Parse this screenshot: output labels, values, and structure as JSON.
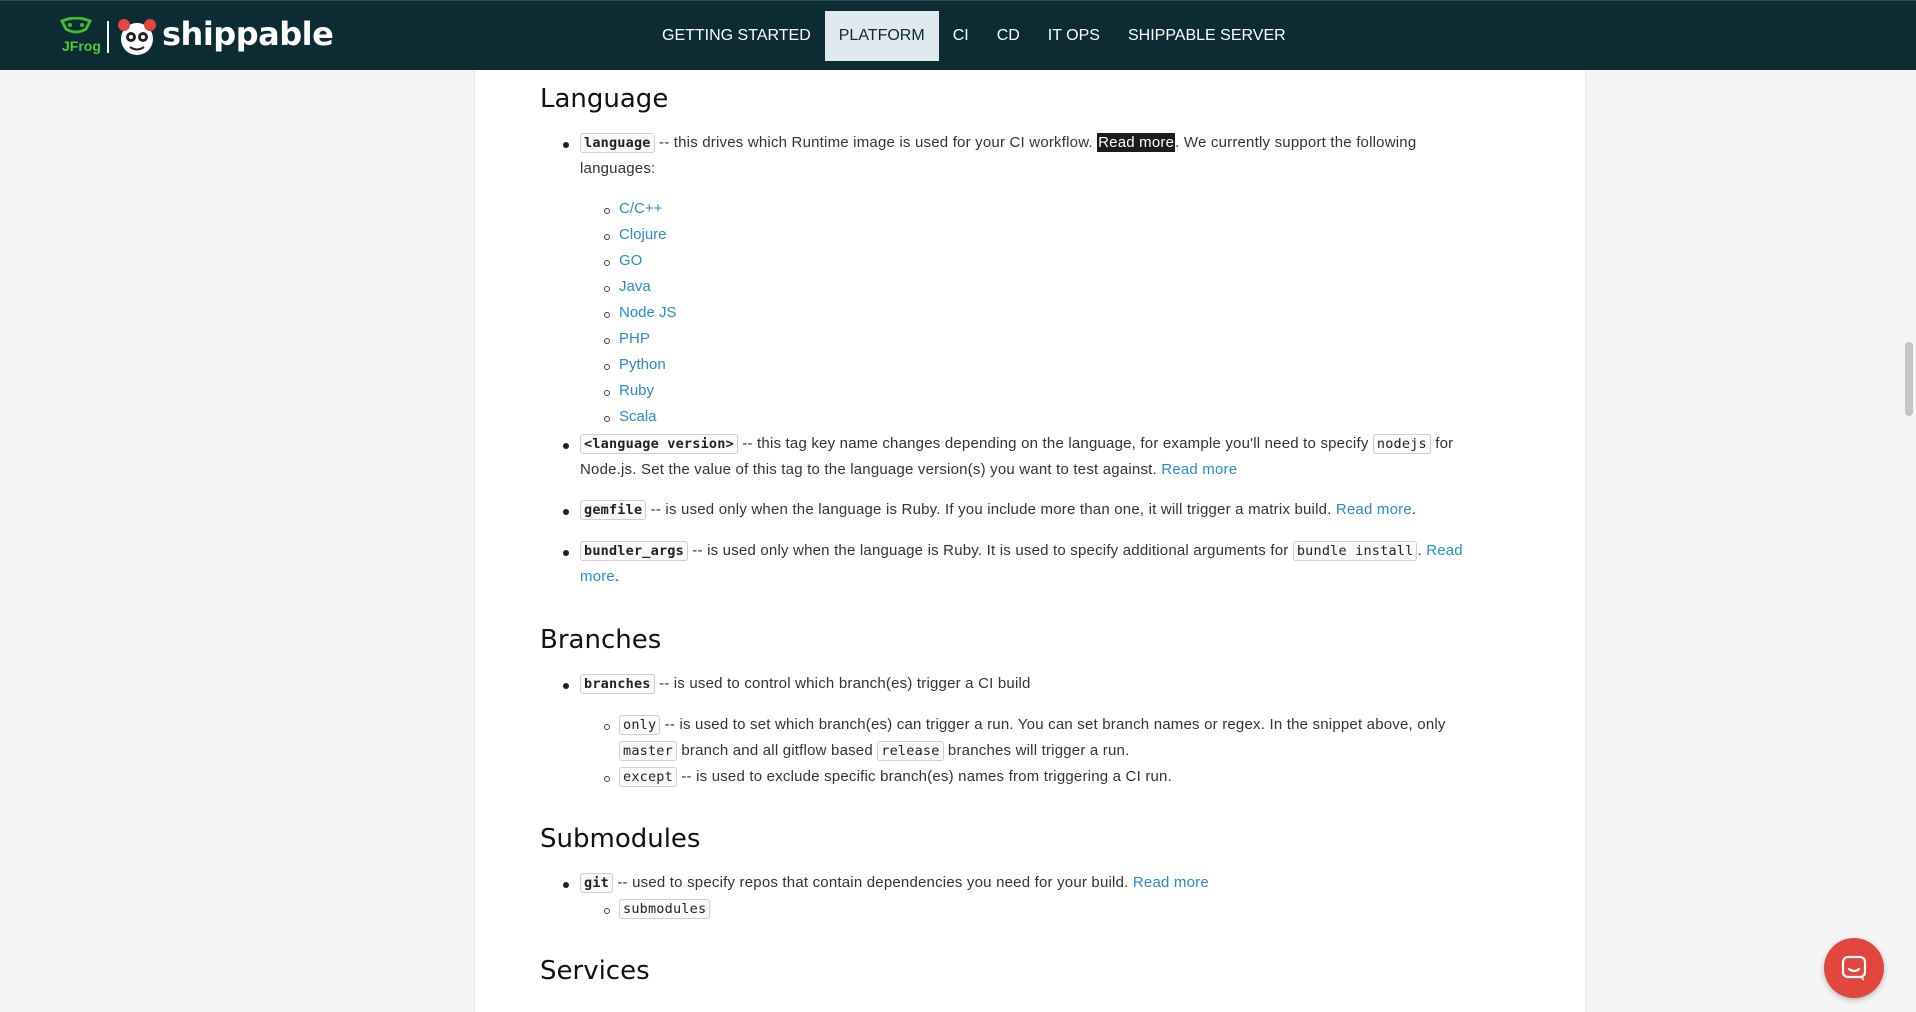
{
  "brand": {
    "jfrog": "JFrog",
    "name": "shippable"
  },
  "nav": [
    {
      "label": "GETTING STARTED",
      "active": false
    },
    {
      "label": "PLATFORM",
      "active": true
    },
    {
      "label": "CI",
      "active": false
    },
    {
      "label": "CD",
      "active": false
    },
    {
      "label": "IT OPS",
      "active": false
    },
    {
      "label": "SHIPPABLE SERVER",
      "active": false
    }
  ],
  "language": {
    "heading": "Language",
    "item1": {
      "code": "language",
      "text_a": " -- this drives which Runtime image is used for your CI workflow. ",
      "link": "Read more",
      "text_b": ". We currently support the following",
      "text_c": "languages:"
    },
    "languages": [
      "C/C++",
      "Clojure",
      "GO",
      "Java",
      "Node JS",
      "PHP",
      "Python",
      "Ruby",
      "Scala"
    ],
    "item2": {
      "code": "<language version>",
      "text_a": " -- this tag key name changes depending on the language, for example you'll need to specify ",
      "code2": "nodejs",
      "text_b": " for",
      "text_c": "Node.js. Set the value of this tag to the language version(s) you want to test against. ",
      "link": "Read more"
    },
    "item3": {
      "code": "gemfile",
      "text_a": " -- is used only when the language is Ruby. If you include more than one, it will trigger a matrix build. ",
      "link": "Read more",
      "text_b": "."
    },
    "item4": {
      "code": "bundler_args",
      "text_a": " -- is used only when the language is Ruby. It is used to specify additional arguments for ",
      "code2": "bundle install",
      "text_b": ". ",
      "link_a": "Read",
      "link_b": "more",
      "text_c": "."
    }
  },
  "branches": {
    "heading": "Branches",
    "item1": {
      "code": "branches",
      "text": " -- is used to control which branch(es) trigger a CI build"
    },
    "only": {
      "code": "only",
      "text_a": " -- is used to set which branch(es) can trigger a run. You can set branch names or regex. In the snippet above, only",
      "code2": "master",
      "text_b": " branch and all gitflow based ",
      "code3": "release",
      "text_c": " branches will trigger a run."
    },
    "except": {
      "code": "except",
      "text": " -- is used to exclude specific branch(es) names from triggering a CI run."
    }
  },
  "submodules": {
    "heading": "Submodules",
    "item1": {
      "code": "git",
      "text": " -- used to specify repos that contain dependencies you need for your build. ",
      "link": "Read more"
    },
    "sub": "submodules"
  },
  "services": {
    "heading": "Services"
  }
}
